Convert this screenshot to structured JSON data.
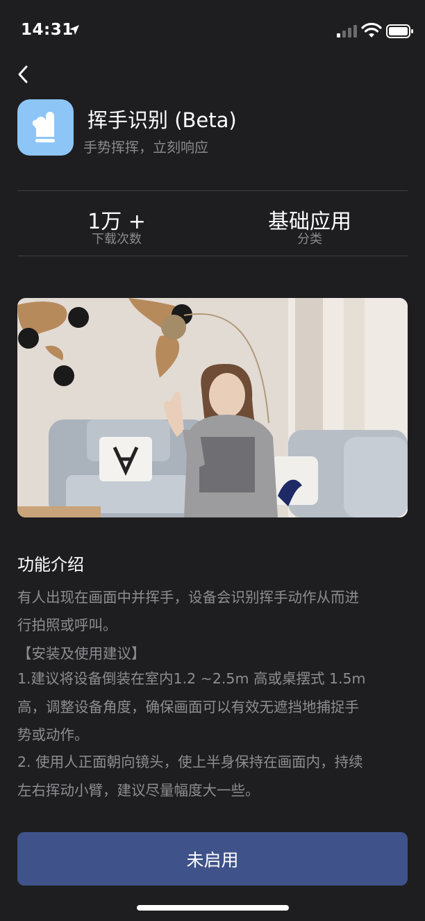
{
  "status_bar": {
    "time": "14:31"
  },
  "app": {
    "name": "挥手识别 (Beta)",
    "tagline": "手势挥挥，立刻响应",
    "icon": "glove-icon",
    "icon_bg": "#8dc5f7"
  },
  "stats": [
    {
      "value": "1万 +",
      "label": "下载次数"
    },
    {
      "value": "基础应用",
      "label": "分类"
    }
  ],
  "hero_image": {
    "description_icon": "waving-person-photo"
  },
  "intro": {
    "title": "功能介绍",
    "lines": [
      "有人出现在画面中并挥手，设备会识别挥手动作从而进",
      "行拍照或呼叫。",
      "【安装及使用建议】",
      "1.建议将设备倒装在室内1.2 ~2.5m 高或桌摆式 1.5m",
      "高，调整设备角度，确保画面可以有效无遮挡地捕捉手",
      "势或动作。",
      "2. 使用人正面朝向镜头，使上半身保持在画面内，持续",
      "左右挥动小臂，建议尽量幅度大一些。"
    ]
  },
  "action_button": {
    "label": "未启用",
    "color": "#3f528a"
  },
  "colors": {
    "background": "#1e1e20",
    "muted_text": "#8d8d92"
  }
}
